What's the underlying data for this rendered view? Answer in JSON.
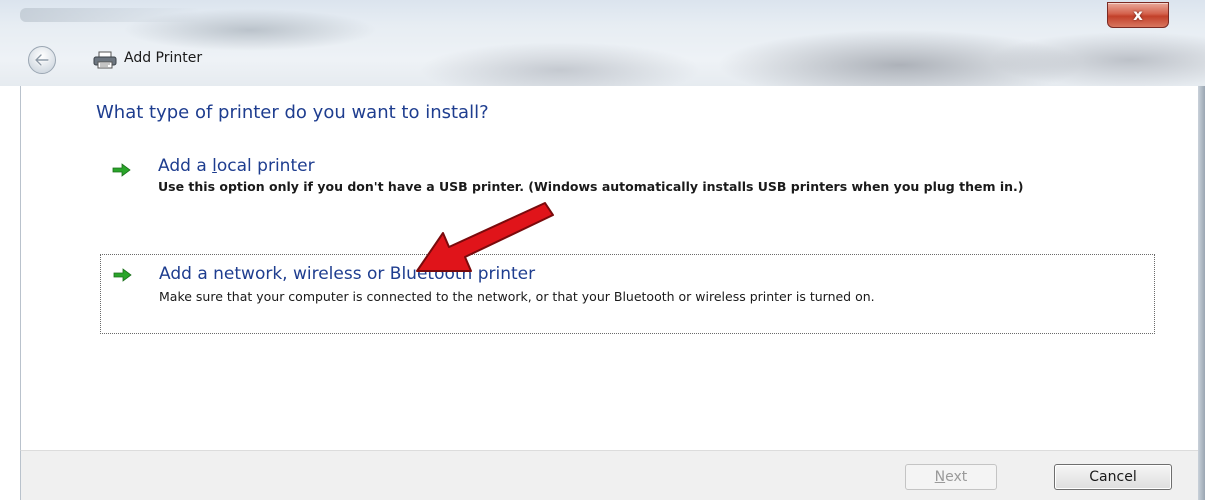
{
  "window": {
    "title": "Add Printer",
    "close_glyph": "x"
  },
  "page": {
    "heading": "What type of printer do you want to install?"
  },
  "options": [
    {
      "title_before": "Add a ",
      "title_access": "l",
      "title_after": "ocal printer",
      "description": "Use this option only if you don't have a USB printer. (Windows automatically installs USB printers when you plug them in.)",
      "icon": "green-arrow-icon"
    },
    {
      "title": "Add a network, wireless or Bluetooth printer",
      "description": "Make sure that your computer is connected to the network, or that your Bluetooth or wireless printer is turned on.",
      "icon": "green-arrow-icon",
      "selected": true
    }
  ],
  "footer": {
    "next_label_access": "N",
    "next_label_rest": "ext",
    "next_enabled": false,
    "cancel_label": "Cancel"
  },
  "colors": {
    "heading": "#1e3d8f",
    "annotation_arrow": "#e0141a"
  }
}
